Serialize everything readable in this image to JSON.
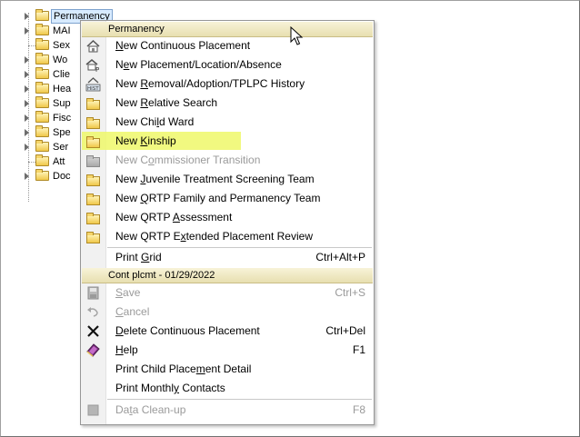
{
  "tree": {
    "items": [
      {
        "label": "Permanency",
        "icon": "open-folder-icon"
      },
      {
        "label": "MAI",
        "icon": "folder-icon"
      },
      {
        "label": "Sex",
        "icon": "folder-icon"
      },
      {
        "label": "Wo",
        "icon": "folder-icon"
      },
      {
        "label": "Clie",
        "icon": "folder-icon"
      },
      {
        "label": "Hea",
        "icon": "folder-icon"
      },
      {
        "label": "Sup",
        "icon": "folder-icon"
      },
      {
        "label": "Fisc",
        "icon": "folder-icon"
      },
      {
        "label": "Spe",
        "icon": "folder-icon"
      },
      {
        "label": "Ser",
        "icon": "folder-icon"
      },
      {
        "label": "Att",
        "icon": "folder-icon"
      },
      {
        "label": "Doc",
        "icon": "folder-icon"
      }
    ]
  },
  "menu": {
    "header1": "Permanency",
    "items1": [
      {
        "pre": "",
        "ul": "N",
        "post": "ew Continuous Placement",
        "icon": "house-icon",
        "disabled": false
      },
      {
        "pre": "N",
        "ul": "e",
        "post": "w Placement/Location/Absence",
        "icon": "placement-house-icon",
        "disabled": false
      },
      {
        "pre": "New ",
        "ul": "R",
        "post": "emoval/Adoption/TPLPC History",
        "icon": "history-icon",
        "disabled": false
      },
      {
        "pre": "New ",
        "ul": "R",
        "post": "elative Search",
        "icon": "folder-icon",
        "disabled": false
      },
      {
        "pre": "New Chi",
        "ul": "l",
        "post": "d Ward",
        "icon": "folder-icon",
        "disabled": false
      },
      {
        "pre": "New ",
        "ul": "K",
        "post": "inship",
        "icon": "folder-icon",
        "disabled": false
      },
      {
        "pre": "New C",
        "ul": "o",
        "post": "mmissioner Transition",
        "icon": "gray-folder-icon",
        "disabled": true
      },
      {
        "pre": "New ",
        "ul": "J",
        "post": "uvenile Treatment Screening Team",
        "icon": "folder-icon",
        "disabled": false
      },
      {
        "pre": "New ",
        "ul": "Q",
        "post": "RTP Family and Permanency Team",
        "icon": "folder-icon",
        "disabled": false
      },
      {
        "pre": "New QRTP ",
        "ul": "A",
        "post": "ssessment",
        "icon": "folder-icon",
        "disabled": false
      },
      {
        "pre": "New QRTP E",
        "ul": "x",
        "post": "tended Placement Review",
        "icon": "folder-icon",
        "disabled": false
      },
      {
        "pre": "Print ",
        "ul": "G",
        "post": "rid",
        "icon": "",
        "disabled": false,
        "shortcut": "Ctrl+Alt+P"
      }
    ],
    "header2": "Cont plcmt - 01/29/2022",
    "items2": [
      {
        "pre": "",
        "ul": "S",
        "post": "ave",
        "icon": "save-icon",
        "disabled": true,
        "shortcut": "Ctrl+S"
      },
      {
        "pre": "",
        "ul": "C",
        "post": "ancel",
        "icon": "undo-icon",
        "disabled": true,
        "shortcut": ""
      },
      {
        "pre": "",
        "ul": "D",
        "post": "elete Continuous Placement",
        "icon": "delete-x-icon",
        "disabled": false,
        "shortcut": "Ctrl+Del"
      },
      {
        "pre": "",
        "ul": "H",
        "post": "elp",
        "icon": "help-book-icon",
        "disabled": false,
        "shortcut": "F1"
      },
      {
        "pre": "Print Child Place",
        "ul": "m",
        "post": "ent Detail",
        "icon": "",
        "disabled": false,
        "shortcut": ""
      },
      {
        "pre": "Print Monthl",
        "ul": "y",
        "post": " Contacts",
        "icon": "",
        "disabled": false,
        "shortcut": ""
      },
      {
        "pre": "Da",
        "ul": "t",
        "post": "a Clean-up",
        "icon": "gray-box-icon",
        "disabled": true,
        "shortcut": "F8"
      }
    ],
    "highlight_color": "#eef86a"
  }
}
